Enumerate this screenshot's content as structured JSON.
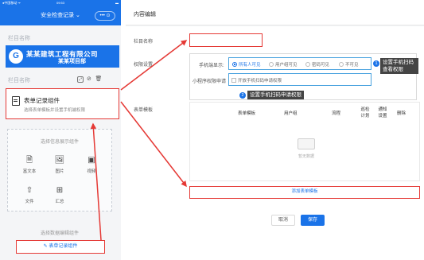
{
  "phone": {
    "status_left": "●中国移动 ᯤ",
    "status_time": "09:53",
    "status_right": "▬",
    "title": "安全检查记录 ⌄",
    "capsule": "••• ⊙",
    "label_column_name_1": "栏目名称",
    "banner": {
      "logo": "G",
      "line1": "某某建筑工程有限公司",
      "line2": "某某项目部"
    },
    "label_column_name_2": "栏目名称",
    "record_card": {
      "name": "表单记录组件",
      "desc": "选择表单模板并设置手机端权限"
    },
    "component_box_title": "选择信息展示组件",
    "components": [
      {
        "label": "富文本",
        "icon": "rich-text"
      },
      {
        "label": "图片",
        "icon": "image"
      },
      {
        "label": "视频",
        "icon": "video"
      },
      {
        "label": "文件",
        "icon": "file-upload"
      },
      {
        "label": "汇总",
        "icon": "summary-grid"
      }
    ],
    "data_component_title": "选择数据编辑组件",
    "data_component_button": "表单记录组件"
  },
  "panel": {
    "header_title": "内容编辑",
    "column_name_label": "栏目名称",
    "permission_label": "权限设置",
    "mobile_display_label": "手机端显示:",
    "radio_options": [
      "所有人可见",
      "用户组可见",
      "密码可见",
      "不可见"
    ],
    "radio_selected": "所有人可见",
    "tip1_badge": "1",
    "tip1_text_line1": "设置手机扫码",
    "tip1_text_line2": "查看权限",
    "mini_program_label": "小程序权限申请",
    "mini_program_checkbox": "开放手机扫码申请权限",
    "tip2_badge": "2",
    "tip2_text": "设置手机扫码申请权限",
    "form_template_label": "表单模板",
    "table_headers": [
      "表单模板",
      "用户组",
      "流程",
      "巡检计划",
      "通知设置",
      "删除"
    ],
    "empty_text": "暂无数据",
    "add_template_button": "添加表单模板",
    "cancel_button": "取消",
    "save_button": "保存"
  },
  "colors": {
    "brand_blue": "#1a73e8",
    "highlight_red": "#e53935",
    "tip_blue_border": "#4aa3df",
    "tip_dark": "#444444"
  }
}
